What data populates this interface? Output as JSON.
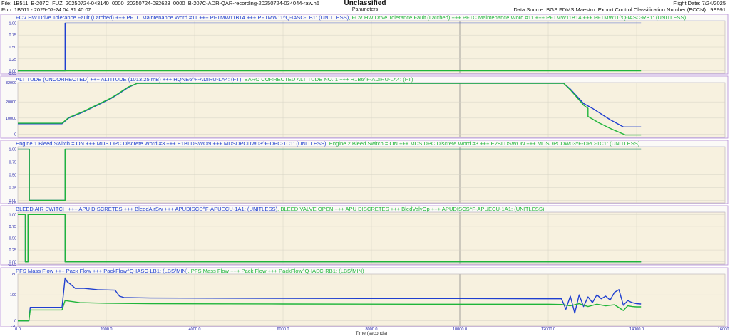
{
  "header": {
    "file": "File: 1B511_B-207C_FUZ_20250724-043140_0000_20250724-082628_0000_B-207C-ADR-QAR-recording-20250724-034044-raw.h5",
    "run": "Run: 1B511 - 2025-07-24 04:31:40.0Z",
    "classification": "Unclassified",
    "subtitle": "Parameters",
    "flight_date": "Flight Date: 7/24/2025",
    "data_source": "Data Source: BGS.FDMS.Maestro. Export Control Classification Number (ECCN) : 9E991"
  },
  "colors": {
    "blue": "#1f3fd0",
    "green": "#1fb53a",
    "plot_bg": "#f7f1df",
    "frame": "#b38ad6",
    "grid": "#d6d2c4",
    "axis_text": "#1a1aa6"
  },
  "chart_data": [
    {
      "type": "line",
      "series": [
        {
          "name": "FCV HW Drive Tolerance Fault (Latched) +++ PFTC Maintenance Word #11 +++ PFTMW11B14 +++ PFTMW11^Q-IASC-LB1: (UNITLESS)",
          "color": "blue",
          "x": [
            0,
            1070,
            1070,
            14100
          ],
          "y": [
            0,
            0,
            1,
            1
          ]
        },
        {
          "name": "FCV HW Drive Tolerance Fault (Latched) +++ PFTC Maintenance Word #11 +++ PFTMW11B14 +++ PFTMW11^Q-IASC-RB1: (UNITLESS)",
          "color": "green",
          "x": [
            0,
            14100
          ],
          "y": [
            0,
            0
          ]
        }
      ],
      "yticks": [
        "1.00",
        "0.75",
        "0.50",
        "0.25",
        "0.00",
        "-0.05"
      ],
      "ylim": [
        -0.05,
        1.05
      ],
      "xlim": [
        0,
        16000
      ],
      "xticks": [
        0,
        2000,
        4000,
        6000,
        8000,
        10000,
        12000,
        14000,
        16000
      ]
    },
    {
      "type": "line",
      "series": [
        {
          "name": "ALTITUDE (UNCORRECTED) +++ ALTITUDE (1013.25 mB) +++ HQNE6^F-ADIRU-LA4: (FT)",
          "color": "blue",
          "x": [
            0,
            1000,
            1150,
            1500,
            1800,
            2100,
            2250,
            2500,
            2700,
            3000,
            12350,
            12500,
            12800,
            13000,
            13400,
            13700,
            14100
          ],
          "y": [
            6500,
            6500,
            10000,
            14000,
            18000,
            22000,
            24500,
            29000,
            31500,
            31500,
            31500,
            28000,
            19000,
            16000,
            9000,
            4500,
            4500
          ]
        },
        {
          "name": "BARO CORRECTED ALTITUDE NO. 1 +++ H1B6^F-ADIRU-LA4: (FT)",
          "color": "green",
          "x": [
            0,
            1000,
            1150,
            1500,
            1800,
            2100,
            2250,
            2500,
            2700,
            3000,
            12350,
            12500,
            12800,
            12900,
            12900,
            13150,
            13450,
            13750,
            14100
          ],
          "y": [
            6800,
            6800,
            10300,
            14300,
            18300,
            22300,
            24800,
            29300,
            31500,
            31500,
            31500,
            27500,
            18000,
            16000,
            11000,
            7000,
            3000,
            -500,
            -500
          ]
        }
      ],
      "yticks": [
        "32000",
        "20000",
        "10000",
        "0"
      ],
      "ylim": [
        -2000,
        32000
      ],
      "xlim": [
        0,
        16000
      ],
      "xticks": [
        0,
        2000,
        4000,
        6000,
        8000,
        10000,
        12000,
        14000,
        16000
      ]
    },
    {
      "type": "line",
      "series": [
        {
          "name": "Engine 1 Bleed Switch = ON +++ MDS DPC Discrete Word #3 +++ E1BLDSWON +++ MDSDPCDW03^F-DPC-1C1: (UNITLESS)",
          "color": "blue",
          "x": [
            0,
            260,
            260,
            1070,
            1070,
            14100
          ],
          "y": [
            1,
            1,
            0,
            0,
            1,
            1
          ]
        },
        {
          "name": "Engine 2 Bleed Switch = ON +++ MDS DPC Discrete Word #3 +++ E2BLDSWON +++ MDSDPCDW03^F-DPC-1C1: (UNITLESS)",
          "color": "green",
          "x": [
            0,
            260,
            260,
            1070,
            1070,
            14100
          ],
          "y": [
            1,
            1,
            0,
            0,
            1,
            1
          ]
        }
      ],
      "yticks": [
        "1.00",
        "0.75",
        "0.50",
        "0.25",
        "0.00",
        "-0.05"
      ],
      "ylim": [
        -0.05,
        1.05
      ],
      "xlim": [
        0,
        16000
      ],
      "xticks": [
        0,
        2000,
        4000,
        6000,
        8000,
        10000,
        12000,
        14000,
        16000
      ]
    },
    {
      "type": "line",
      "series": [
        {
          "name": "BLEED AIR SWITCH +++ APU DISCRETES +++ BleedAirSw +++ APUDISCS^F-APUECU-1A1: (UNITLESS)",
          "color": "blue",
          "x": [
            0,
            170,
            170,
            230,
            230,
            1070,
            1070,
            14100
          ],
          "y": [
            1,
            1,
            0,
            0,
            1,
            1,
            0,
            0
          ]
        },
        {
          "name": "BLEED VALVE OPEN +++ APU DISCRETES +++ BledValvOp +++ APUDISCS^F-APUECU-1A1: (UNITLESS)",
          "color": "green",
          "x": [
            0,
            170,
            170,
            230,
            230,
            1070,
            1070,
            14100
          ],
          "y": [
            1,
            1,
            0,
            0,
            1,
            1,
            0,
            0
          ]
        }
      ],
      "yticks": [
        "1.00",
        "0.75",
        "0.50",
        "0.25",
        "0.00",
        "-0.05"
      ],
      "ylim": [
        -0.05,
        1.05
      ],
      "xlim": [
        0,
        16000
      ],
      "xticks": [
        0,
        2000,
        4000,
        6000,
        8000,
        10000,
        12000,
        14000,
        16000
      ]
    },
    {
      "type": "line",
      "series": [
        {
          "name": "PFS Mass Flow +++ Pack Flow +++ PackFlow^Q-IASC-LB1: (LBS/MIN)",
          "color": "blue",
          "x": [
            0,
            250,
            280,
            1000,
            1070,
            1120,
            1200,
            1300,
            1500,
            1800,
            2200,
            2300,
            2400,
            3000,
            5000,
            8000,
            10000,
            12000,
            12300,
            12400,
            12500,
            12600,
            12700,
            12800,
            12900,
            13000,
            13100,
            13200,
            13300,
            13400,
            13500,
            13600,
            13700,
            13800,
            13900,
            14000,
            14100
          ],
          "y": [
            0,
            0,
            52,
            52,
            165,
            150,
            140,
            125,
            125,
            120,
            118,
            95,
            90,
            88,
            87,
            86,
            86,
            85,
            85,
            45,
            95,
            30,
            100,
            55,
            92,
            70,
            100,
            85,
            95,
            80,
            110,
            120,
            60,
            78,
            70,
            66,
            65
          ]
        },
        {
          "name": "PFS Mass Flow +++ Pack Flow +++ PackFlow^Q-IASC-RB1: (LBS/MIN)",
          "color": "green",
          "x": [
            0,
            250,
            280,
            1000,
            1070,
            1200,
            1400,
            2000,
            3000,
            6000,
            9000,
            12000,
            12300,
            12500,
            12700,
            12900,
            13100,
            13300,
            13500,
            13700,
            13800,
            13900,
            14000,
            14100
          ],
          "y": [
            0,
            0,
            42,
            42,
            78,
            75,
            70,
            68,
            66,
            65,
            64,
            64,
            63,
            58,
            66,
            55,
            64,
            58,
            62,
            40,
            58,
            55,
            54,
            54
          ]
        }
      ],
      "yticks": [
        "180",
        "100",
        "0",
        "-20"
      ],
      "ylim": [
        -20,
        180
      ],
      "xlim": [
        0,
        16000
      ],
      "xticks": [
        0,
        2000,
        4000,
        6000,
        8000,
        10000,
        12000,
        14000,
        16000
      ]
    }
  ],
  "x_tick_labels": [
    "0.0",
    "2000.0",
    "4000.0",
    "6000.0",
    "8000.0",
    "10000.0",
    "12000.0",
    "14000.0",
    "16000.0"
  ],
  "x_axis_title": "Time (seconds)"
}
